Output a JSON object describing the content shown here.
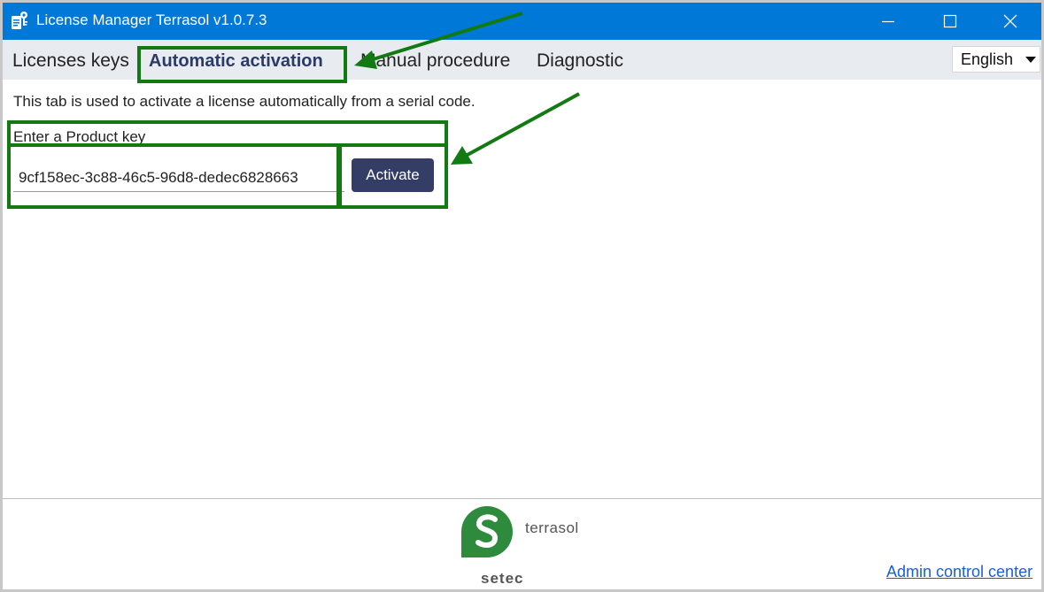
{
  "window": {
    "title": "License Manager Terrasol v1.0.7.3"
  },
  "tabs": [
    {
      "label": "Licenses keys",
      "active": false
    },
    {
      "label": "Automatic activation",
      "active": true
    },
    {
      "label": "Manual procedure",
      "active": false
    },
    {
      "label": "Diagnostic",
      "active": false
    }
  ],
  "language": {
    "selected": "English"
  },
  "content": {
    "description": "This tab is used to activate a license automatically from a serial code.",
    "product_key_label": "Enter a Product key",
    "product_key_value": "9cf158ec-3c88-46c5-96d8-dedec6828663",
    "activate_label": "Activate"
  },
  "footer": {
    "brand_name": "terrasol",
    "brand_sub": "setec",
    "admin_link": "Admin control center"
  },
  "colors": {
    "titlebar": "#0078d7",
    "tabbar": "#e8ebf0",
    "active_tab": "#2b3a67",
    "activate_button": "#333d66",
    "highlight": "#137a13",
    "logo_green": "#2e8b3e",
    "link": "#1a5fd6"
  }
}
